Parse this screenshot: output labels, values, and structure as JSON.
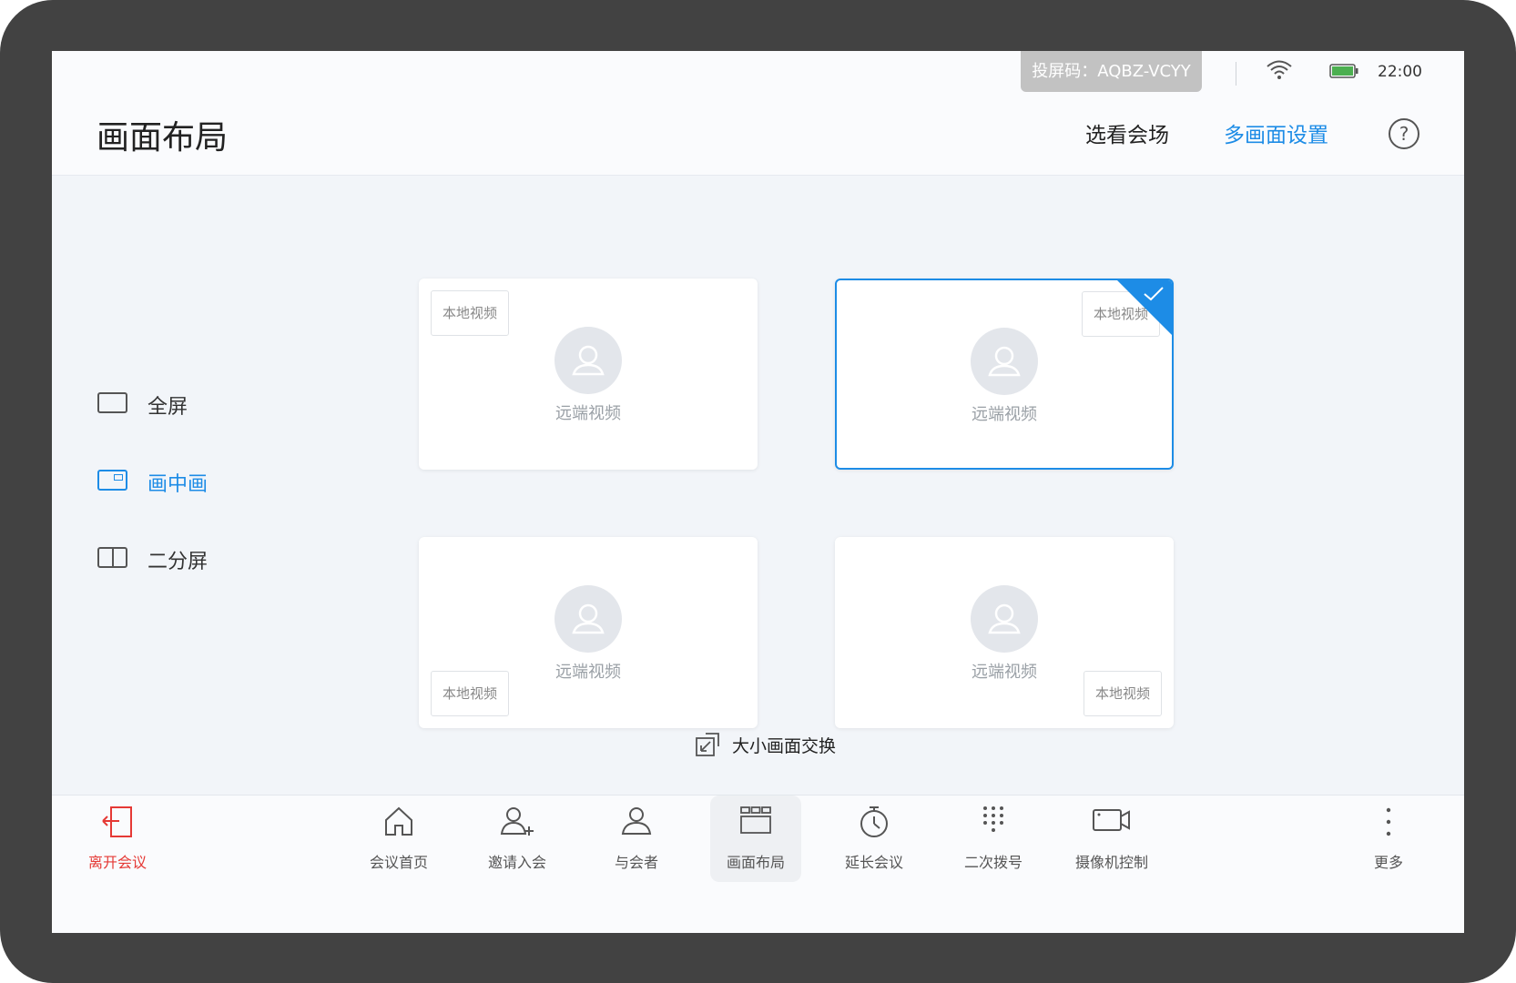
{
  "status_bar": {
    "cast_code": "投屏码：AQBZ-VCYY",
    "time": "22:00",
    "icons": [
      "wifi-icon",
      "battery-icon"
    ],
    "battery_color": "#4caf50"
  },
  "header": {
    "title": "画面布局",
    "tabs": [
      {
        "label": "选看会场",
        "active": false
      },
      {
        "label": "多画面设置",
        "active": true
      }
    ],
    "help_icon": "?"
  },
  "layout_modes": [
    {
      "label": "全屏",
      "icon": "fullscreen-icon",
      "active": false
    },
    {
      "label": "画中画",
      "icon": "picture-in-picture-icon",
      "active": true
    },
    {
      "label": "二分屏",
      "icon": "split-screen-icon",
      "active": false
    }
  ],
  "layout_options": [
    {
      "remote_label": "远端视频",
      "local_label": "本地视频",
      "local_position": "top-left",
      "selected": false
    },
    {
      "remote_label": "远端视频",
      "local_label": "本地视频",
      "local_position": "top-right",
      "selected": true
    },
    {
      "remote_label": "远端视频",
      "local_label": "本地视频",
      "local_position": "bottom-left",
      "selected": false
    },
    {
      "remote_label": "远端视频",
      "local_label": "本地视频",
      "local_position": "bottom-right",
      "selected": false
    }
  ],
  "swap_button": {
    "label": "大小画面交换",
    "icon": "swap-icon"
  },
  "toolbar": {
    "leave": {
      "label": "离开会议",
      "icon": "exit-icon",
      "color": "#e53935"
    },
    "items": [
      {
        "label": "会议首页",
        "icon": "home-icon"
      },
      {
        "label": "邀请入会",
        "icon": "invite-icon"
      },
      {
        "label": "与会者",
        "icon": "participants-icon"
      },
      {
        "label": "画面布局",
        "icon": "layout-icon",
        "active": true
      },
      {
        "label": "延长会议",
        "icon": "timer-icon"
      },
      {
        "label": "二次拨号",
        "icon": "dialpad-icon"
      },
      {
        "label": "摄像机控制",
        "icon": "camera-icon"
      }
    ],
    "more": {
      "label": "更多",
      "icon": "more-icon"
    }
  },
  "colors": {
    "accent": "#1d8ce6",
    "danger": "#e53935"
  }
}
